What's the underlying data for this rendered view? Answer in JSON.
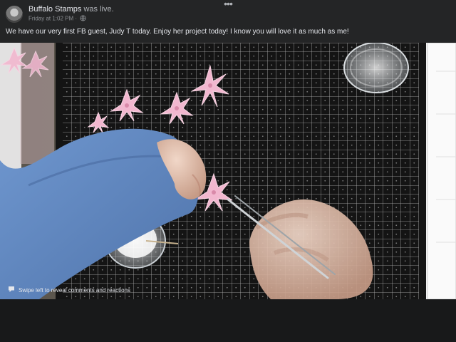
{
  "post": {
    "author": "Buffalo Stamps",
    "action": "was live.",
    "timestamp": "Friday at 1:02 PM",
    "separator": "·",
    "more_label": "•••",
    "text": "We have our very first FB guest, Judy T today.  Enjoy her project today!  I know you will love it as much as me!"
  },
  "video": {
    "overlay_hint": "Swipe left to reveal comments and reactions"
  },
  "colors": {
    "background": "#18191a",
    "header_bg": "#242526",
    "text_primary": "#e4e6eb",
    "text_secondary": "#b0b3b8",
    "mat_dark": "#141414",
    "grid_line": "#d8d8d8",
    "flower_pink": "#f2b7cf",
    "sleeve_blue": "#5f86bf"
  },
  "icons": [
    "avatar",
    "globe-icon",
    "more-icon",
    "comment-icon"
  ]
}
